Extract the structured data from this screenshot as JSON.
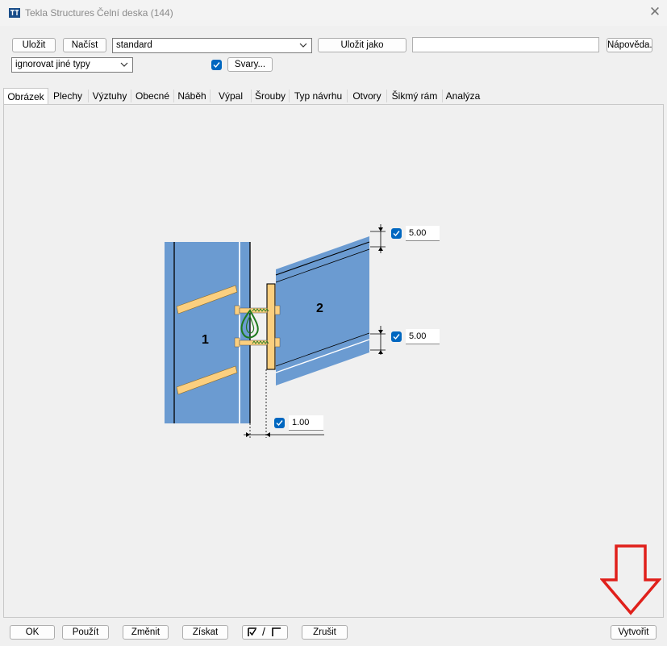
{
  "window": {
    "app_name": "Tekla Structures",
    "document_title": "Čelní deska (144)"
  },
  "toolbar": {
    "save_label": "Uložit",
    "load_label": "Načíst",
    "preset_value": "standard",
    "save_as_label": "Uložit jako",
    "save_as_name": "",
    "help_label": "Nápověda...",
    "ignore_types_value": "ignorovat jiné typy",
    "welds_label": "Svary..."
  },
  "tabs": [
    "Obrázek",
    "Plechy",
    "Výztuhy",
    "Obecné",
    "Náběh",
    "Výpal",
    "Šrouby",
    "Typ návrhu",
    "Otvory",
    "Šikmý rám",
    "Analýza"
  ],
  "active_tab": "Obrázek",
  "picture": {
    "label_part1": "1",
    "label_part2": "2",
    "top_offset": "5.00",
    "bottom_offset": "5.00",
    "gap": "1.00"
  },
  "footer": {
    "ok_label": "OK",
    "apply_label": "Použít",
    "modify_label": "Změnit",
    "get_label": "Získat",
    "toggle_separator": "/",
    "cancel_label": "Zrušit",
    "create_label": "Vytvořit"
  },
  "colors": {
    "beam_blue": "#6b9bd1",
    "plate_orange": "#fbcf7f",
    "weld_green": "#1e7a1e",
    "checkbox_blue": "#0067c0",
    "arrow_red": "#e0201b"
  }
}
